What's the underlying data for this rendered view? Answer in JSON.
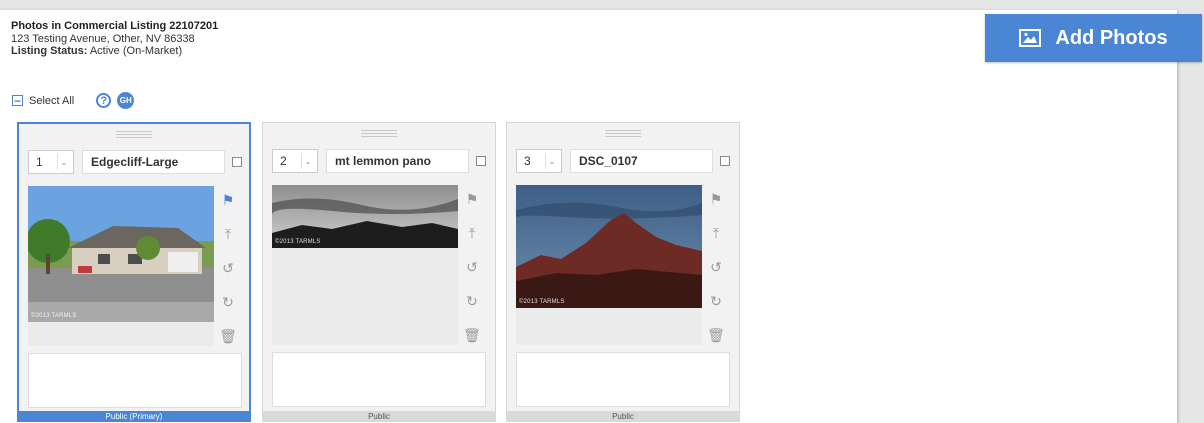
{
  "header": {
    "title": "Photos in Commercial Listing 22107201",
    "address": "123 Testing Avenue, Other, NV 86338",
    "status_label": "Listing Status:",
    "status_value": "Active (On-Market)"
  },
  "add_photos": {
    "label": "Add Photos",
    "icon": "picture-icon"
  },
  "toolbar": {
    "select_all": "Select All",
    "help_icon": "help-icon",
    "gh_badge": "GH"
  },
  "photos": [
    {
      "order": "1",
      "name": "Edgecliff-Large",
      "watermark": "©2013 TARMLS",
      "visibility": "Public (Primary)",
      "selected": true
    },
    {
      "order": "2",
      "name": "mt lemmon pano",
      "watermark": "©2013 TARMLS",
      "visibility": "Public",
      "selected": false
    },
    {
      "order": "3",
      "name": "DSC_0107",
      "watermark": "©2013 TARMLS",
      "visibility": "Public",
      "selected": false
    }
  ],
  "actions": [
    "flag-icon",
    "upload-icon",
    "rotate-left-icon",
    "rotate-right-icon",
    "trash-icon"
  ],
  "colors": {
    "accent": "#4a86d4",
    "card_bg": "#f2f2f2",
    "page_bg": "#ffffff"
  }
}
